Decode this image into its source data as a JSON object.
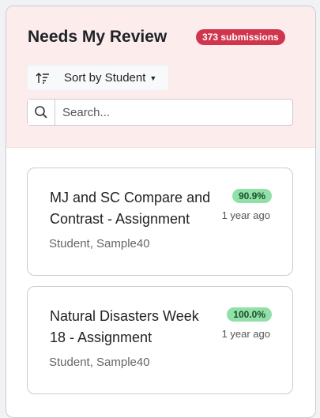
{
  "header": {
    "title": "Needs My Review",
    "badge": "373 submissions",
    "sort_label": "Sort by Student",
    "search_placeholder": "Search..."
  },
  "cards": [
    {
      "title": "MJ and SC Compare and Contrast - Assignment",
      "student": "Student, Sample40",
      "score": "90.9%",
      "time": "1 year ago"
    },
    {
      "title": "Natural Disasters Week 18 - Assignment",
      "student": "Student, Sample40",
      "score": "100.0%",
      "time": "1 year ago"
    }
  ],
  "colors": {
    "header_bg": "#fcecec",
    "badge_bg": "#d0354c",
    "score_bg": "#90e0a8"
  }
}
